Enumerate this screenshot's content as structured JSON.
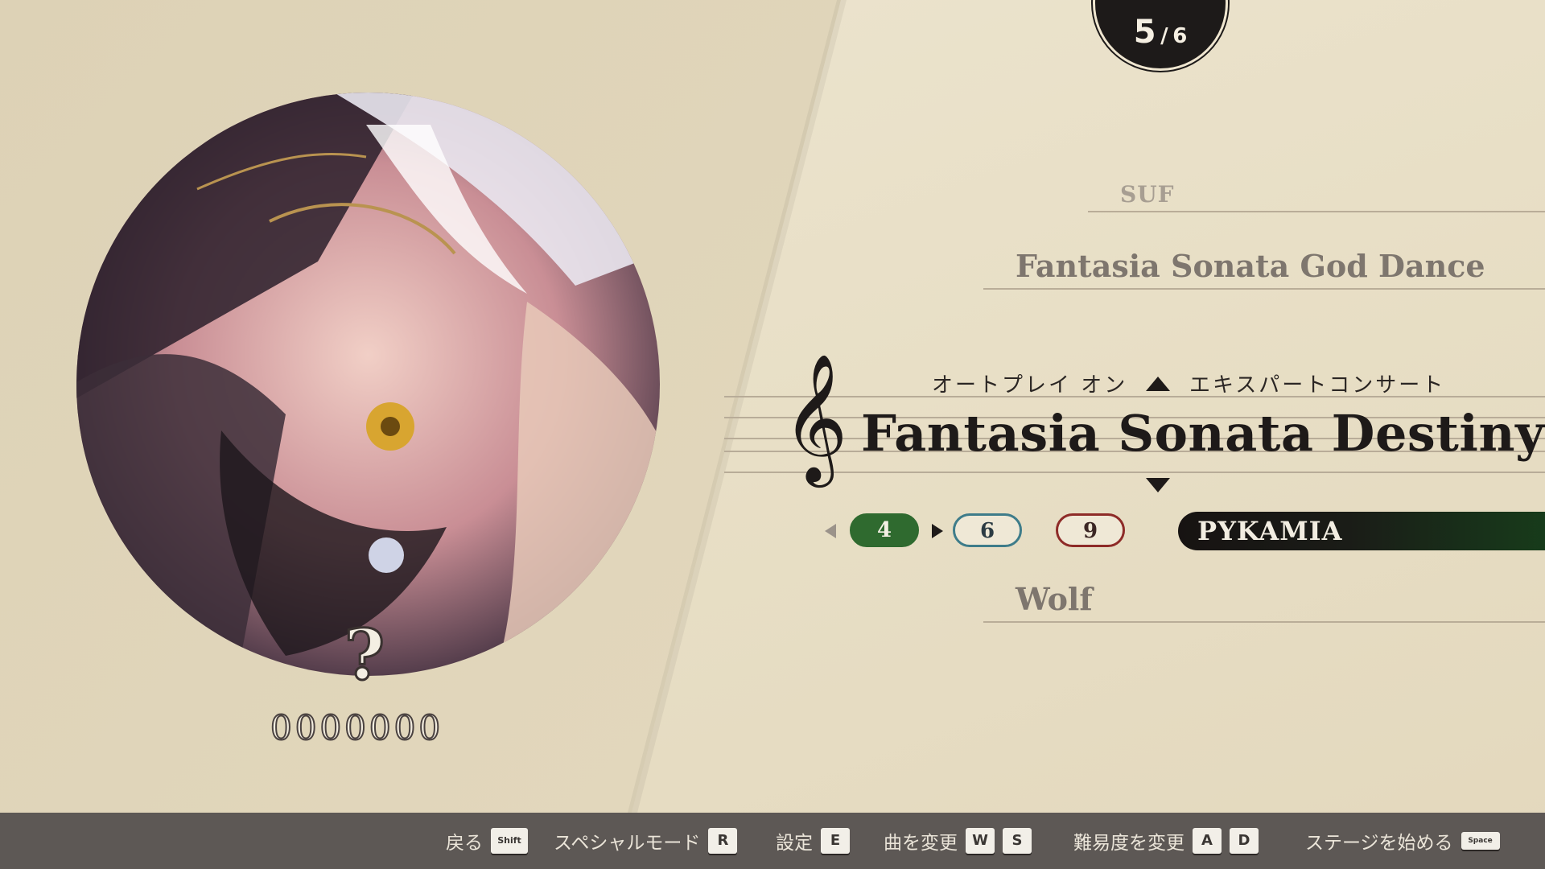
{
  "page_counter": {
    "current": "5",
    "separator": "/",
    "total": "6"
  },
  "song_list": {
    "prev_2": "SUF",
    "prev_1": "Fantasia Sonata God Dance",
    "selected": "Fantasia Sonata Destiny",
    "next_1": "Wolf"
  },
  "selected_song": {
    "autoplay_label": "オートプレイ オン",
    "mode_label": "エキスパートコンサート",
    "clef_symbol": "𝄞",
    "difficulties": {
      "easy": "4",
      "normal": "6",
      "hard": "9"
    },
    "artist": "PYKAMIA"
  },
  "jacket": {
    "mystery_mark": "?",
    "score": "0000000"
  },
  "footer": {
    "back_label": "戻る",
    "back_key": "Shift",
    "special_label": "スペシャルモード",
    "special_key": "R",
    "settings_label": "設定",
    "settings_key": "E",
    "change_song_label": "曲を変更",
    "change_song_key_1": "W",
    "change_song_key_2": "S",
    "change_diff_label": "難易度を変更",
    "change_diff_key_1": "A",
    "change_diff_key_2": "D",
    "start_label": "ステージを始める",
    "start_key": "Space"
  },
  "colors": {
    "easy": "#2f6a2f",
    "normal": "#3e7c8a",
    "hard": "#8e2b28",
    "artist_bar_end": "#173d1b",
    "bottom_bar": "#5d5855"
  }
}
